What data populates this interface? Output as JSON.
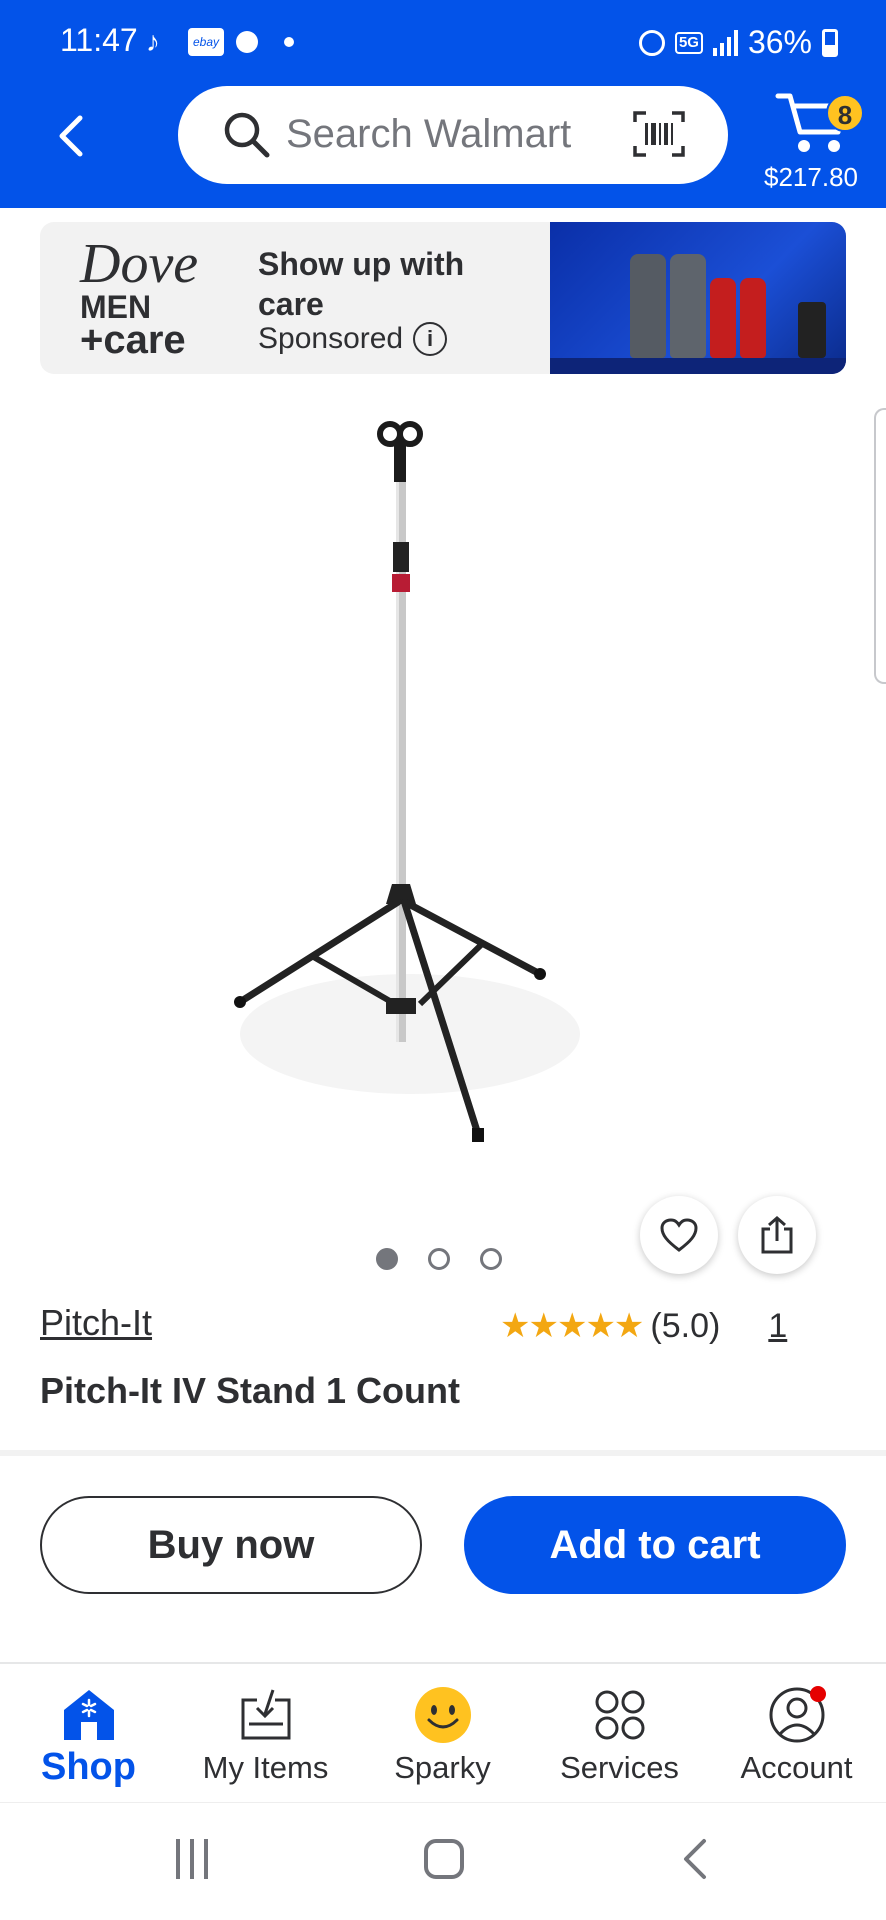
{
  "status_bar": {
    "time": "11:47",
    "battery": "36%",
    "network": "5G"
  },
  "header": {
    "search_placeholder": "Search Walmart",
    "cart_count": "8",
    "cart_total": "$217.80"
  },
  "ad": {
    "brand_line1": "Dove",
    "brand_line2": "MEN",
    "brand_line3": "+care",
    "headline": "Show up with care",
    "sponsored_label": "Sponsored",
    "info_glyph": "i"
  },
  "product": {
    "brand": "Pitch-It",
    "title": "Pitch-It IV Stand 1 Count",
    "stars": "★★★★★",
    "rating": 5.0,
    "rating_text": "(5.0)",
    "review_count": "1",
    "image_count": 3,
    "active_image": 1
  },
  "actions": {
    "buy_now": "Buy now",
    "add_to_cart": "Add to cart"
  },
  "bottom_nav": {
    "items": [
      {
        "label": "Shop",
        "icon": "shop-icon",
        "active": true
      },
      {
        "label": "My Items",
        "icon": "my-items-icon",
        "active": false
      },
      {
        "label": "Sparky",
        "icon": "sparky-icon",
        "active": false
      },
      {
        "label": "Services",
        "icon": "services-icon",
        "active": false
      },
      {
        "label": "Account",
        "icon": "account-icon",
        "active": false
      }
    ]
  },
  "colors": {
    "brand_blue": "#0353e9",
    "spark_yellow": "#ffc220",
    "star": "#f3a712",
    "text": "#2e2f32"
  }
}
